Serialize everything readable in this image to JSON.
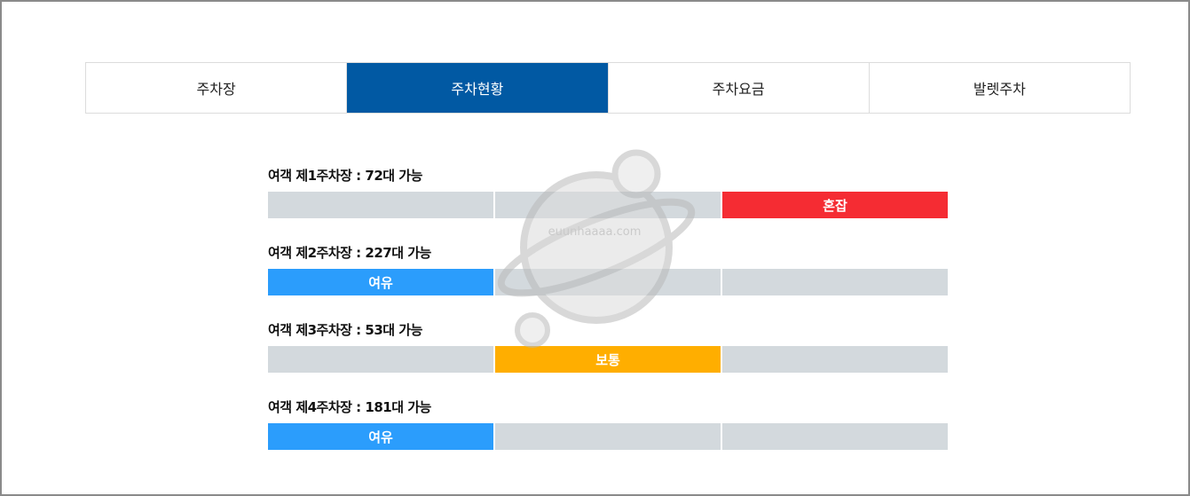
{
  "tabs": [
    {
      "label": "주차장",
      "active": false
    },
    {
      "label": "주차현황",
      "active": true
    },
    {
      "label": "주차요금",
      "active": false
    },
    {
      "label": "발렛주차",
      "active": false
    }
  ],
  "lots": [
    {
      "title": "여객 제1주차장 : 72대 가능",
      "status": "혼잡",
      "status_color": "#f52c33",
      "active_segment": 3
    },
    {
      "title": "여객 제2주차장 : 227대 가능",
      "status": "여유",
      "status_color": "#2b9dfc",
      "active_segment": 1
    },
    {
      "title": "여객 제3주차장 : 53대 가능",
      "status": "보통",
      "status_color": "#ffae00",
      "active_segment": 2
    },
    {
      "title": "여객 제4주차장 : 181대 가능",
      "status": "여유",
      "status_color": "#2b9dfc",
      "active_segment": 1
    }
  ],
  "colors": {
    "tab_active_bg": "#0159a3",
    "segment_idle": "#d3d9dd"
  },
  "watermark": {
    "text": "euunhaaaa.com",
    "icon": "planet-icon"
  }
}
